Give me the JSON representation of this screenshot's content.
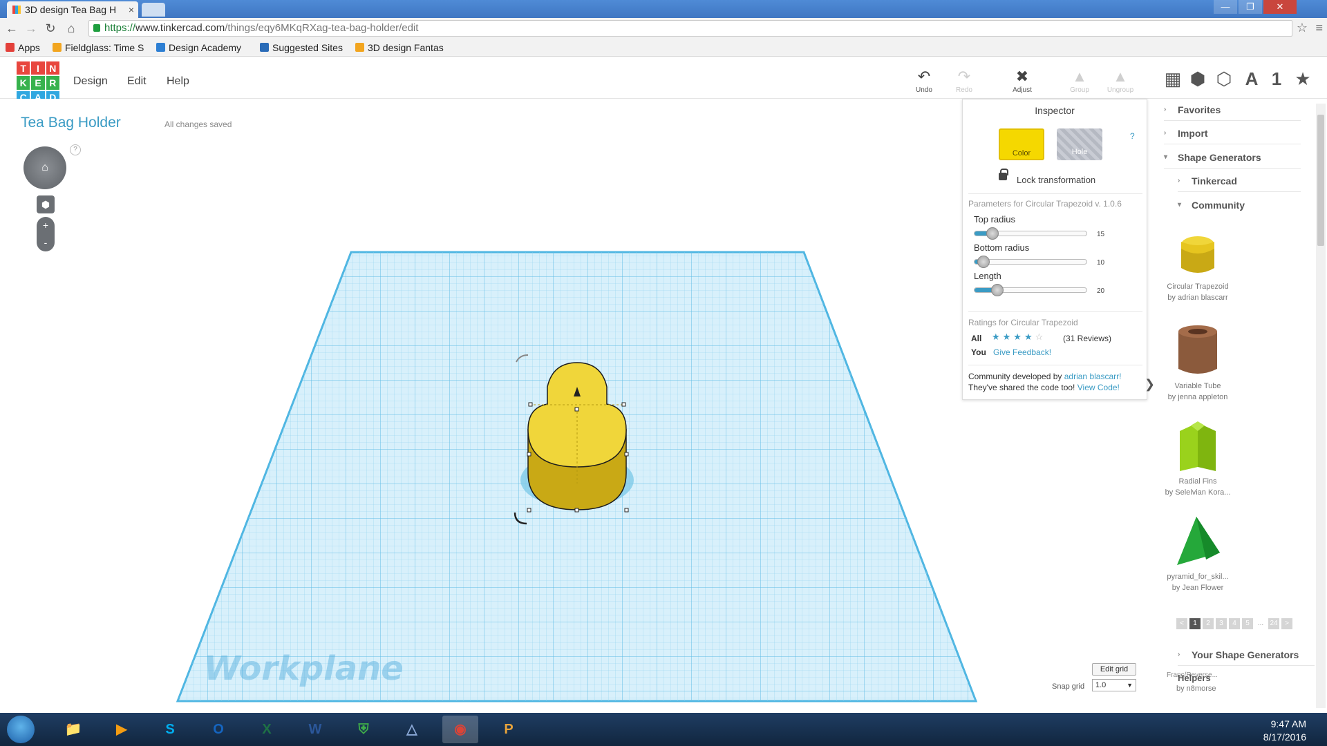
{
  "browser": {
    "tab_title": "3D design Tea Bag H",
    "tab_close": "×",
    "url_scheme": "https://",
    "url_host": "www.tinkercad.com",
    "url_path": "/things/eqy6MKqRXag-tea-bag-holder/edit",
    "window_controls": [
      "—",
      "❐",
      "✕"
    ]
  },
  "bookmarks": [
    {
      "label": "Apps",
      "color": "#e3403a"
    },
    {
      "label": "Fieldglass: Time S",
      "color": "#f2a51f"
    },
    {
      "label": "Design Academy",
      "color": "#2d7fd3"
    },
    {
      "label": "Suggested Sites",
      "color": "#2a6cb8"
    },
    {
      "label": "3D design Fantas",
      "color": "#f2a51f"
    }
  ],
  "app": {
    "logo_letters": [
      "T",
      "I",
      "N",
      "K",
      "E",
      "R",
      "C",
      "A",
      "D"
    ],
    "logo_colors": [
      "#e8463e",
      "#e8463e",
      "#e8463e",
      "#37b24d",
      "#37b24d",
      "#37b24d",
      "#2fa7e0",
      "#2fa7e0",
      "#2fa7e0"
    ],
    "menu": [
      "Design",
      "Edit",
      "Help"
    ],
    "tools": [
      {
        "label": "Undo",
        "glyph": "↶",
        "enabled": true
      },
      {
        "label": "Redo",
        "glyph": "↷",
        "enabled": false
      },
      {
        "label": "Adjust",
        "glyph": "✖",
        "enabled": true
      },
      {
        "label": "Group",
        "glyph": "▲",
        "enabled": false
      },
      {
        "label": "Ungroup",
        "glyph": "▲",
        "enabled": false
      }
    ],
    "view_icons": [
      {
        "name": "grid-view-icon",
        "glyph": "▦"
      },
      {
        "name": "solid-cube-icon",
        "glyph": "⬢"
      },
      {
        "name": "wireframe-cube-icon",
        "glyph": "⬡"
      },
      {
        "name": "text-tool-icon",
        "glyph": "A"
      },
      {
        "name": "number-tool-icon",
        "glyph": "1"
      },
      {
        "name": "favorites-star-icon",
        "glyph": "★"
      }
    ]
  },
  "design": {
    "title": "Tea Bag Holder",
    "save_status": "All changes saved",
    "help": "?",
    "zoom_in": "+",
    "zoom_out": "-",
    "workplane_label": "Workplane",
    "edit_grid": "Edit grid",
    "snap_label": "Snap grid",
    "snap_value": "1.0",
    "shape_color": "#f0d63a"
  },
  "inspector": {
    "title": "Inspector",
    "color_label": "Color",
    "hole_label": "Hole",
    "help": "?",
    "lock_label": "Lock transformation",
    "params_title": "Parameters for Circular Trapezoid v. 1.0.6",
    "params": [
      {
        "label": "Top radius",
        "value": "15",
        "fraction": 0.13
      },
      {
        "label": "Bottom radius",
        "value": "10",
        "fraction": 0.05
      },
      {
        "label": "Length",
        "value": "20",
        "fraction": 0.17
      }
    ],
    "ratings_title": "Ratings for Circular Trapezoid",
    "all_label": "All",
    "stars_filled": "★★★★",
    "stars_empty": "☆",
    "reviews": "(31 Reviews)",
    "you_label": "You",
    "feedback": "Give Feedback!",
    "community_prefix": "Community developed by ",
    "community_author": "adrian blascarr!",
    "code_prefix": "They've shared the code too! ",
    "code_link": "View Code!"
  },
  "sidebar": {
    "rows": [
      {
        "label": "Favorites",
        "arrow": "›"
      },
      {
        "label": "Import",
        "arrow": "›"
      },
      {
        "label": "Shape Generators",
        "arrow": "▾"
      },
      {
        "label": "Tinkercad",
        "arrow": "›"
      },
      {
        "label": "Community",
        "arrow": "▾"
      }
    ],
    "shapes": [
      {
        "name": "Circular Trapezoid",
        "by": "by adrian blascarr"
      },
      {
        "name": "Variable Tube",
        "by": "by jenna appleton"
      },
      {
        "name": "Radial Fins",
        "by": "by Selelvian Kora..."
      },
      {
        "name": "pyramid_for_skil...",
        "by": "by Jean Flower"
      }
    ],
    "pager": [
      "<",
      "1",
      "2",
      "3",
      "4",
      "5",
      "...",
      "24",
      ">"
    ],
    "your_generators": "Your Shape Generators",
    "helpers": "Helpers",
    "extra_item": "Franc/Reverse...",
    "extra_by": "by n8morse"
  },
  "taskbar": {
    "apps": [
      {
        "name": "file-explorer",
        "glyph": "📁",
        "color": "#e8b84a"
      },
      {
        "name": "media-player",
        "glyph": "▶",
        "color": "#f39c12"
      },
      {
        "name": "skype",
        "glyph": "S",
        "color": "#00aff0"
      },
      {
        "name": "outlook",
        "glyph": "O",
        "color": "#1565c0"
      },
      {
        "name": "excel",
        "glyph": "X",
        "color": "#1e7145"
      },
      {
        "name": "word",
        "glyph": "W",
        "color": "#2b579a"
      },
      {
        "name": "security",
        "glyph": "⛨",
        "color": "#3fae49"
      },
      {
        "name": "autodesk",
        "glyph": "△",
        "color": "#8aa8d6"
      },
      {
        "name": "chrome",
        "glyph": "◉",
        "color": "#db4437"
      },
      {
        "name": "powerpoint",
        "glyph": "P",
        "color": "#e8a33b"
      }
    ],
    "time": "9:47 AM",
    "date": "8/17/2016"
  }
}
